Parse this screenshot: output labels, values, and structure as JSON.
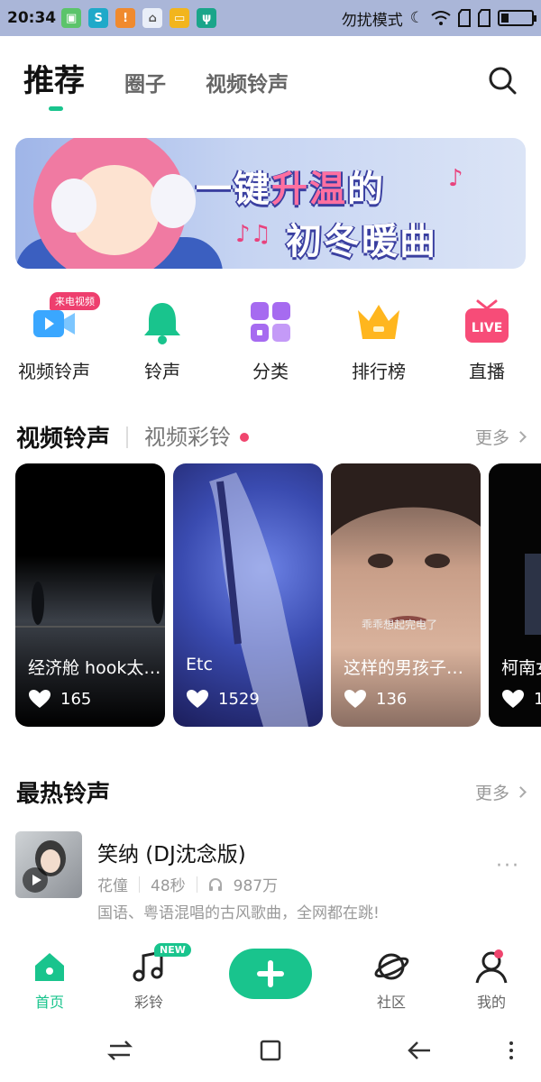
{
  "status": {
    "time": "20:34",
    "mode": "勿扰模式",
    "colors": {
      "bar": "#aab6d8"
    }
  },
  "tabs": [
    {
      "label": "推荐",
      "active": true
    },
    {
      "label": "圈子"
    },
    {
      "label": "视频铃声"
    }
  ],
  "banner": {
    "line1_a": "一键",
    "line1_hl": "升温",
    "line1_b": "的",
    "line2": "初冬暖曲",
    "note": "♪♫"
  },
  "categories": [
    {
      "label": "视频铃声",
      "badge": "来电视频",
      "icon": "video-icon",
      "color": "#3aa7ff"
    },
    {
      "label": "铃声",
      "icon": "bell-icon",
      "color": "#19c48d"
    },
    {
      "label": "分类",
      "icon": "grid-icon",
      "color": "#a66bf0"
    },
    {
      "label": "排行榜",
      "icon": "crown-icon",
      "color": "#ffb61e"
    },
    {
      "label": "直播",
      "icon": "live-tv-icon",
      "color": "#f74c78",
      "icon_text": "LIVE"
    }
  ],
  "video_section": {
    "title": "视频铃声",
    "sub": "视频彩铃",
    "more": "更多"
  },
  "video_cards": [
    {
      "caption": "经济舱 hook太…",
      "likes": "165"
    },
    {
      "caption": "Etc",
      "likes": "1529"
    },
    {
      "caption": "这样的男孩子，…",
      "likes": "136",
      "overlay": "乖乖想起完电了"
    },
    {
      "caption": "柯南女",
      "likes": "1"
    }
  ],
  "hot_section": {
    "title": "最热铃声",
    "more": "更多"
  },
  "hot_song": {
    "name": "笑纳 (DJ沈念版)",
    "artist": "花僮",
    "duration": "48秒",
    "plays": "987万",
    "desc": "国语、粤语混唱的古风歌曲，全网都在跳!",
    "dots": "···"
  },
  "bottom_nav": [
    {
      "label": "首页",
      "active": true
    },
    {
      "label": "彩铃",
      "badge": "NEW"
    },
    {
      "label": "社区"
    },
    {
      "label": "我的"
    }
  ],
  "accent": "#19c48d"
}
